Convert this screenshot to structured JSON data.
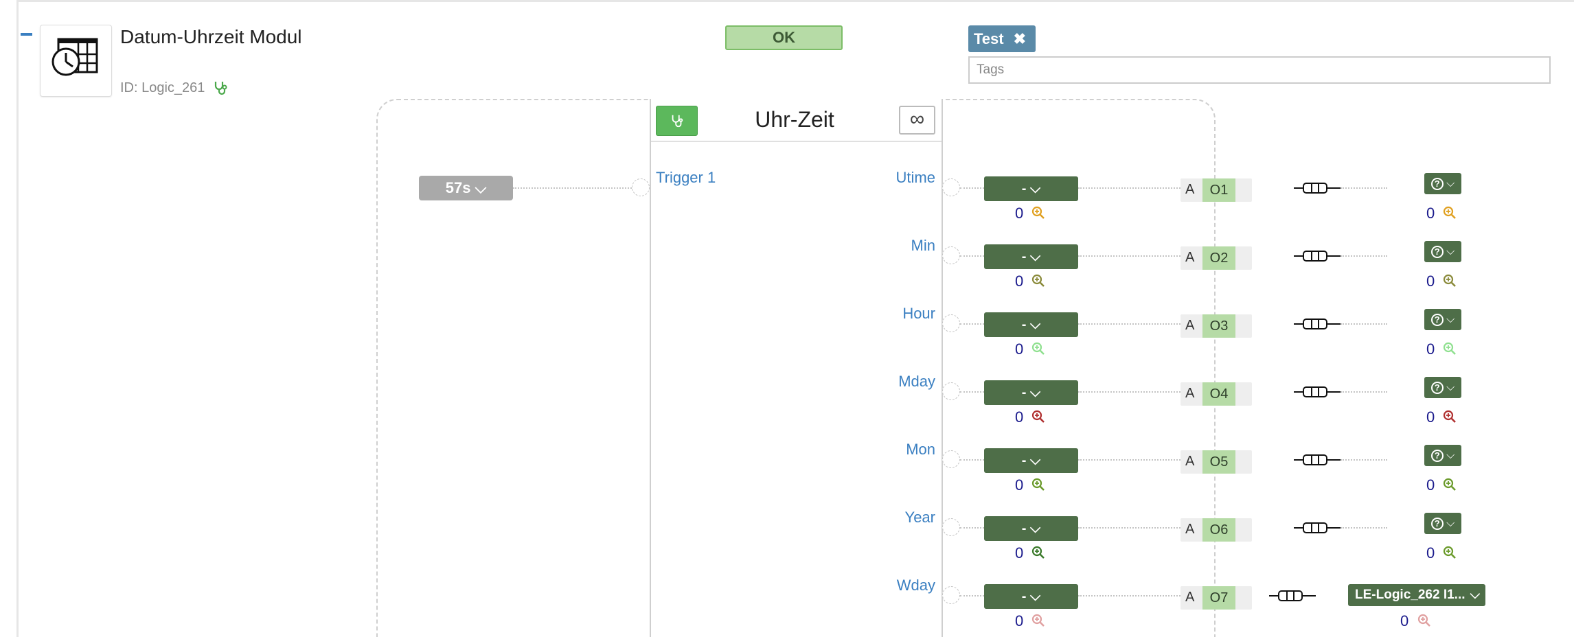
{
  "module": {
    "title": "Datum-Uhrzeit Modul",
    "id_label": "ID: Logic_261",
    "icon": "clock-table-icon",
    "collapse_icon": "minus-icon"
  },
  "status": {
    "label": "OK"
  },
  "tags": {
    "chip_label": "Test",
    "chip_remove_icon": "close-icon",
    "placeholder": "Tags"
  },
  "block": {
    "title": "Uhr-Zeit",
    "debug_icon": "stethoscope-icon",
    "link_icon": "infinity-icon",
    "link_glyph": "∞"
  },
  "inputs": [
    {
      "label": "Trigger 1",
      "source": "57s"
    }
  ],
  "outputs": [
    {
      "label": "Utime",
      "selector": "-",
      "value": "0",
      "assignment": "A",
      "output_id": "O1",
      "target": "?",
      "target_value": "0",
      "zoom_color": "#e0a020",
      "target_zoom_color": "#e0a020"
    },
    {
      "label": "Min",
      "selector": "-",
      "value": "0",
      "assignment": "A",
      "output_id": "O2",
      "target": "?",
      "target_value": "0",
      "zoom_color": "#8a8a3a",
      "target_zoom_color": "#8a8a3a"
    },
    {
      "label": "Hour",
      "selector": "-",
      "value": "0",
      "assignment": "A",
      "output_id": "O3",
      "target": "?",
      "target_value": "0",
      "zoom_color": "#8fe08f",
      "target_zoom_color": "#8fe08f"
    },
    {
      "label": "Mday",
      "selector": "-",
      "value": "0",
      "assignment": "A",
      "output_id": "O4",
      "target": "?",
      "target_value": "0",
      "zoom_color": "#b03030",
      "target_zoom_color": "#b03030"
    },
    {
      "label": "Mon",
      "selector": "-",
      "value": "0",
      "assignment": "A",
      "output_id": "O5",
      "target": "?",
      "target_value": "0",
      "zoom_color": "#6a9a2a",
      "target_zoom_color": "#6a9a2a"
    },
    {
      "label": "Year",
      "selector": "-",
      "value": "0",
      "assignment": "A",
      "output_id": "O6",
      "target": "?",
      "target_value": "0",
      "zoom_color": "#3a7a2a",
      "target_zoom_color": "#6a9a2a"
    },
    {
      "label": "Wday",
      "selector": "-",
      "value": "0",
      "assignment": "A",
      "output_id": "O7",
      "target": "LE-Logic_262 I1...",
      "target_value": "0",
      "zoom_color": "#e0a0a0",
      "target_zoom_color": "#e0a0a0"
    }
  ],
  "colors": {
    "accent_blue": "#3a7fc1",
    "ok_green": "#b6dba6",
    "dark_green": "#4e6e48",
    "tag_blue": "#5a8aa8",
    "value_navy": "#1a1a8c"
  }
}
